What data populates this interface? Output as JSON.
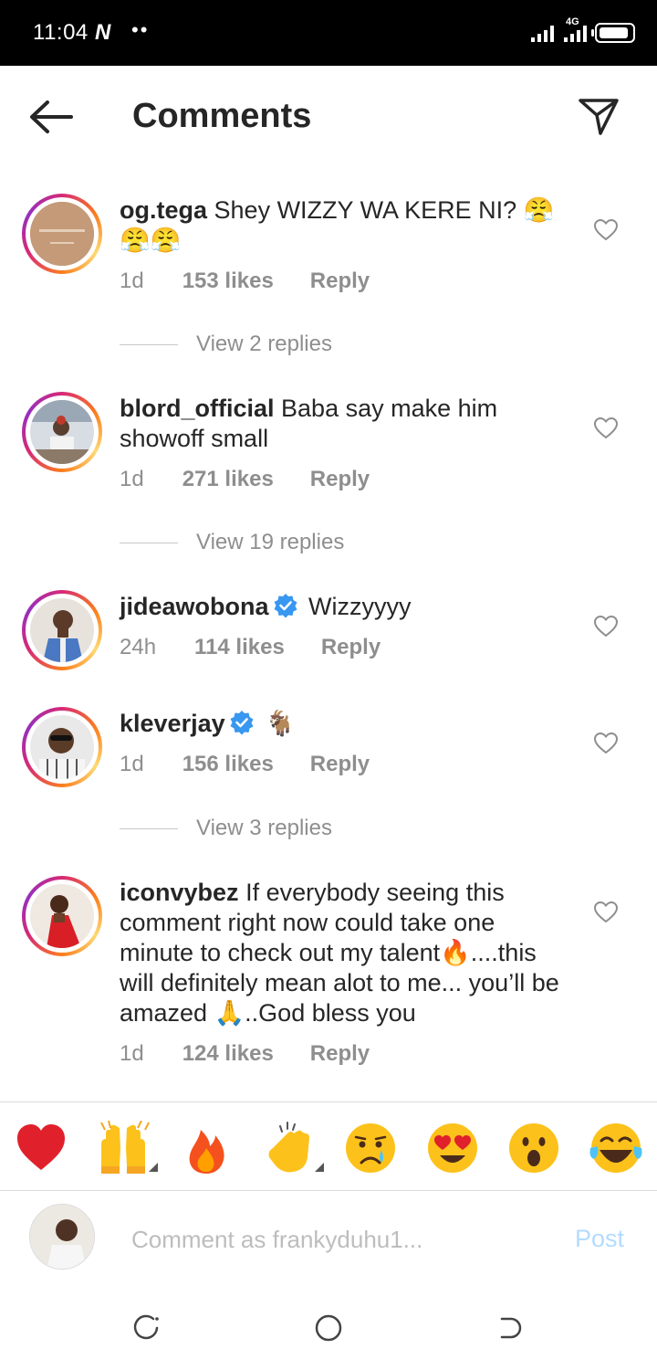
{
  "status_bar": {
    "time": "11:04",
    "n_badge": "N",
    "dots": "••",
    "network": "4G",
    "battery_level": 0.9
  },
  "header": {
    "title": "Comments"
  },
  "comments": [
    {
      "username": "og.tega",
      "text": "Shey WIZZY WA KERE NI? 😤😤😤",
      "time": "1d",
      "likes": "153 likes",
      "reply": "Reply",
      "view_replies": "View 2 replies",
      "verified": false
    },
    {
      "username": "blord_official",
      "text": "Baba say make him showoff small",
      "time": "1d",
      "likes": "271 likes",
      "reply": "Reply",
      "view_replies": "View 19 replies",
      "verified": false
    },
    {
      "username": "jideawobona",
      "text": "Wizzyyyy",
      "time": "24h",
      "likes": "114 likes",
      "reply": "Reply",
      "verified": true
    },
    {
      "username": "kleverjay",
      "text": "🐐",
      "time": "1d",
      "likes": "156 likes",
      "reply": "Reply",
      "view_replies": "View 3 replies",
      "verified": true
    },
    {
      "username": "iconvybez",
      "text": "If everybody seeing this comment right now could take one minute to check out my talent🔥....this will definitely mean alot to me... you’ll be amazed 🙏..God bless you",
      "time": "1d",
      "likes": "124 likes",
      "reply": "Reply",
      "verified": false
    }
  ],
  "emoji_bar": [
    "❤️",
    "🙌",
    "🔥",
    "👏",
    "😢",
    "😍",
    "😮",
    "😂"
  ],
  "input": {
    "placeholder": "Comment as frankyduhu1...",
    "post_label": "Post",
    "post_color": "#b3dbff"
  },
  "colors": {
    "verified": "#3897f0",
    "meta": "#8e8e8e",
    "text": "#262626"
  }
}
